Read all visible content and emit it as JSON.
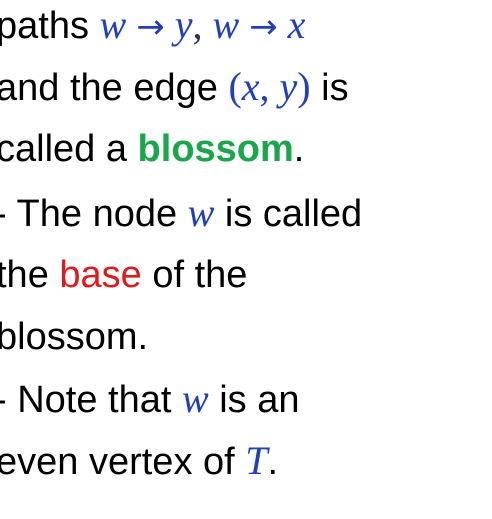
{
  "slide": {
    "l1": {
      "t1": "paths ",
      "w1": "w",
      "arrow1": "→",
      "y1": "y",
      "comma1": ",",
      "w2": "w",
      "arrow2": "→",
      "x1": "x"
    },
    "l2": {
      "t1": "and the edge ",
      "open": "(",
      "x": "x",
      "comma": ",",
      "y": "y",
      "close": ")",
      "t2": " is"
    },
    "l3": {
      "t1": "called a ",
      "blossom": "blossom",
      "t2": "."
    },
    "l4": {
      "t1": "- The node ",
      "w": "w",
      "t2": " is called"
    },
    "l5": {
      "t1": "the ",
      "base": "base",
      "t2": " of the"
    },
    "l6": {
      "t1": "blossom."
    },
    "l7": {
      "t1": "- Note that ",
      "w": "w",
      "t2": " is an"
    },
    "l8": {
      "t1": "even vertex of ",
      "T": "T",
      "t2": "."
    }
  },
  "colors": {
    "math": "#1f3fbf",
    "blossom": "#1aa64a",
    "base": "#e0191b",
    "text": "#000000"
  }
}
